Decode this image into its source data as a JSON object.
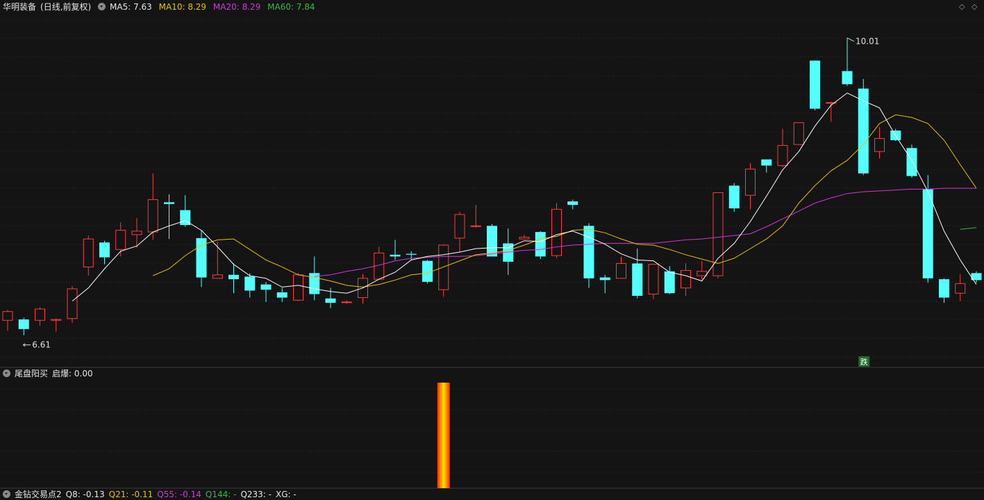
{
  "header": {
    "stock_name": "华明装备",
    "period": "(日线,前复权)",
    "ma5_label": "MA5: 7.63",
    "ma10_label": "MA10: 8.29",
    "ma20_label": "MA20: 8.29",
    "ma60_label": "MA60: 7.84"
  },
  "indicator1": {
    "title": "尾盘阳买",
    "value_label": "启爆: 0.00"
  },
  "indicator2": {
    "title": "金钻交易点2",
    "q8": "Q8: -0.13",
    "q21": "Q21: -0.11",
    "q55": "Q55: -0.14",
    "q144": "Q144: -",
    "q233": "Q233: -",
    "xg": "XG: -"
  },
  "controls": {
    "diamond_icon": "◇",
    "diamond_icon2": "◇"
  },
  "colors": {
    "up": "#ff3b3b",
    "down": "#54ffff",
    "ma5": "#ffffff",
    "ma10": "#e8c000",
    "ma20": "#d633e0",
    "ma60": "#2fbf3c",
    "bg": "#141414",
    "grid": "#2e2e2e"
  },
  "chart_data": {
    "type": "candlestick",
    "y_range": [
      6.25,
      10.3
    ],
    "high_label": "10.01",
    "low_label": "6.61",
    "signal_label": "跌",
    "candles": [
      [
        6.78,
        6.88,
        6.66,
        6.9
      ],
      [
        6.79,
        6.68,
        6.61,
        6.81
      ],
      [
        6.78,
        6.91,
        6.72,
        6.93
      ],
      [
        6.78,
        6.79,
        6.65,
        6.8
      ],
      [
        6.8,
        7.14,
        6.75,
        7.17
      ],
      [
        7.39,
        7.71,
        7.29,
        7.75
      ],
      [
        7.67,
        7.5,
        7.42,
        7.69
      ],
      [
        7.59,
        7.81,
        7.51,
        7.9
      ],
      [
        7.76,
        7.8,
        7.61,
        7.95
      ],
      [
        7.79,
        8.16,
        7.7,
        8.46
      ],
      [
        8.13,
        8.11,
        7.71,
        8.22
      ],
      [
        8.04,
        7.87,
        7.85,
        8.21
      ],
      [
        7.72,
        7.27,
        7.16,
        7.81
      ],
      [
        7.26,
        7.3,
        7.26,
        7.68
      ],
      [
        7.3,
        7.25,
        7.09,
        7.43
      ],
      [
        7.28,
        7.12,
        7.04,
        7.32
      ],
      [
        7.19,
        7.13,
        6.99,
        7.22
      ],
      [
        7.1,
        7.04,
        6.99,
        7.15
      ],
      [
        7.01,
        7.3,
        7.0,
        7.32
      ],
      [
        7.32,
        7.08,
        7.01,
        7.51
      ],
      [
        7.03,
        6.98,
        6.92,
        7.15
      ],
      [
        6.99,
        6.99,
        6.97,
        7.01
      ],
      [
        7.04,
        7.26,
        6.97,
        7.31
      ],
      [
        7.25,
        7.55,
        7.24,
        7.62
      ],
      [
        7.53,
        7.51,
        7.47,
        7.7
      ],
      [
        7.54,
        7.53,
        7.47,
        7.57
      ],
      [
        7.46,
        7.22,
        7.2,
        7.47
      ],
      [
        7.13,
        7.64,
        7.05,
        7.65
      ],
      [
        7.72,
        7.99,
        7.56,
        8.02
      ],
      [
        7.86,
        7.86,
        7.84,
        8.1
      ],
      [
        7.86,
        7.51,
        7.56,
        7.88
      ],
      [
        7.66,
        7.45,
        7.3,
        7.83
      ],
      [
        7.71,
        7.73,
        7.72,
        7.76
      ],
      [
        7.79,
        7.51,
        7.48,
        7.8
      ],
      [
        7.52,
        8.05,
        7.49,
        8.12
      ],
      [
        8.14,
        8.1,
        8.05,
        8.16
      ],
      [
        7.86,
        7.26,
        7.15,
        7.89
      ],
      [
        7.27,
        7.24,
        7.09,
        7.3
      ],
      [
        7.26,
        7.43,
        7.27,
        7.51
      ],
      [
        7.43,
        7.06,
        7.03,
        7.6
      ],
      [
        7.08,
        7.42,
        7.02,
        7.42
      ],
      [
        7.34,
        7.09,
        7.08,
        7.4
      ],
      [
        7.15,
        7.35,
        7.06,
        7.43
      ],
      [
        7.29,
        7.34,
        7.24,
        7.46
      ],
      [
        7.29,
        8.24,
        7.26,
        8.24
      ],
      [
        8.32,
        8.06,
        8.02,
        8.35
      ],
      [
        8.21,
        8.51,
        8.05,
        8.58
      ],
      [
        8.62,
        8.55,
        8.47,
        8.6
      ],
      [
        8.55,
        8.78,
        8.53,
        8.97
      ],
      [
        8.79,
        9.04,
        8.8,
        9.02
      ],
      [
        9.75,
        9.2,
        9.18,
        9.74
      ],
      [
        9.27,
        9.27,
        9.05,
        9.28
      ],
      [
        9.63,
        9.48,
        9.46,
        10.01
      ],
      [
        9.43,
        8.46,
        8.44,
        9.54
      ],
      [
        8.71,
        8.86,
        8.63,
        8.99
      ],
      [
        8.95,
        8.84,
        8.83,
        8.97
      ],
      [
        8.75,
        8.43,
        8.41,
        8.79
      ],
      [
        8.28,
        7.26,
        7.21,
        8.44
      ],
      [
        7.25,
        7.04,
        6.98,
        7.26
      ],
      [
        7.09,
        7.2,
        7.0,
        7.31
      ],
      [
        7.32,
        7.24,
        7.21,
        7.34
      ]
    ],
    "ma5": [
      null,
      null,
      null,
      null,
      7.0,
      7.15,
      7.37,
      7.57,
      7.63,
      7.79,
      7.86,
      7.92,
      7.81,
      7.62,
      7.42,
      7.29,
      7.26,
      7.16,
      7.18,
      7.14,
      7.11,
      7.09,
      7.15,
      7.25,
      7.33,
      7.47,
      7.51,
      7.53,
      7.56,
      7.6,
      7.61,
      7.61,
      7.69,
      7.68,
      7.76,
      7.8,
      7.73,
      7.65,
      7.54,
      7.47,
      7.46,
      7.33,
      7.29,
      7.23,
      7.49,
      7.66,
      7.91,
      8.2,
      8.5,
      8.71,
      9.0,
      9.24,
      9.38,
      9.29,
      9.21,
      8.89,
      8.61,
      8.25,
      7.8,
      7.47,
      7.19
    ],
    "ma10": [
      null,
      null,
      null,
      null,
      null,
      null,
      null,
      null,
      null,
      7.29,
      7.37,
      7.52,
      7.64,
      7.7,
      7.71,
      7.59,
      7.47,
      7.39,
      7.3,
      7.27,
      7.23,
      7.18,
      7.16,
      7.19,
      7.24,
      7.3,
      7.32,
      7.39,
      7.46,
      7.53,
      7.55,
      7.58,
      7.64,
      7.71,
      7.74,
      7.81,
      7.82,
      7.78,
      7.71,
      7.65,
      7.64,
      7.59,
      7.53,
      7.48,
      7.43,
      7.49,
      7.6,
      7.71,
      7.86,
      8.12,
      8.32,
      8.49,
      8.61,
      8.79,
      9.03,
      9.13,
      9.1,
      9.03,
      8.84,
      8.56,
      8.29
    ],
    "ma20": [
      null,
      null,
      null,
      null,
      null,
      null,
      null,
      null,
      null,
      null,
      null,
      null,
      null,
      null,
      null,
      null,
      null,
      null,
      null,
      7.28,
      7.3,
      7.34,
      7.37,
      7.41,
      7.46,
      7.49,
      7.5,
      7.51,
      7.51,
      7.52,
      7.54,
      7.56,
      7.58,
      7.59,
      7.62,
      7.64,
      7.65,
      7.66,
      7.66,
      7.66,
      7.66,
      7.68,
      7.7,
      7.71,
      7.73,
      7.75,
      7.77,
      7.85,
      7.94,
      8.03,
      8.12,
      8.18,
      8.23,
      8.25,
      8.26,
      8.27,
      8.28,
      8.28,
      8.29,
      8.29,
      8.29
    ],
    "ma60": [
      null,
      null,
      null,
      null,
      null,
      null,
      null,
      null,
      null,
      null,
      null,
      null,
      null,
      null,
      null,
      null,
      null,
      null,
      null,
      null,
      null,
      null,
      null,
      null,
      null,
      null,
      null,
      null,
      null,
      null,
      null,
      null,
      null,
      null,
      null,
      null,
      null,
      null,
      null,
      null,
      null,
      null,
      null,
      null,
      null,
      null,
      null,
      null,
      null,
      null,
      null,
      null,
      null,
      null,
      null,
      null,
      null,
      null,
      null,
      7.82,
      7.84
    ],
    "indicator_bar": {
      "index": 27,
      "value": 1
    }
  }
}
